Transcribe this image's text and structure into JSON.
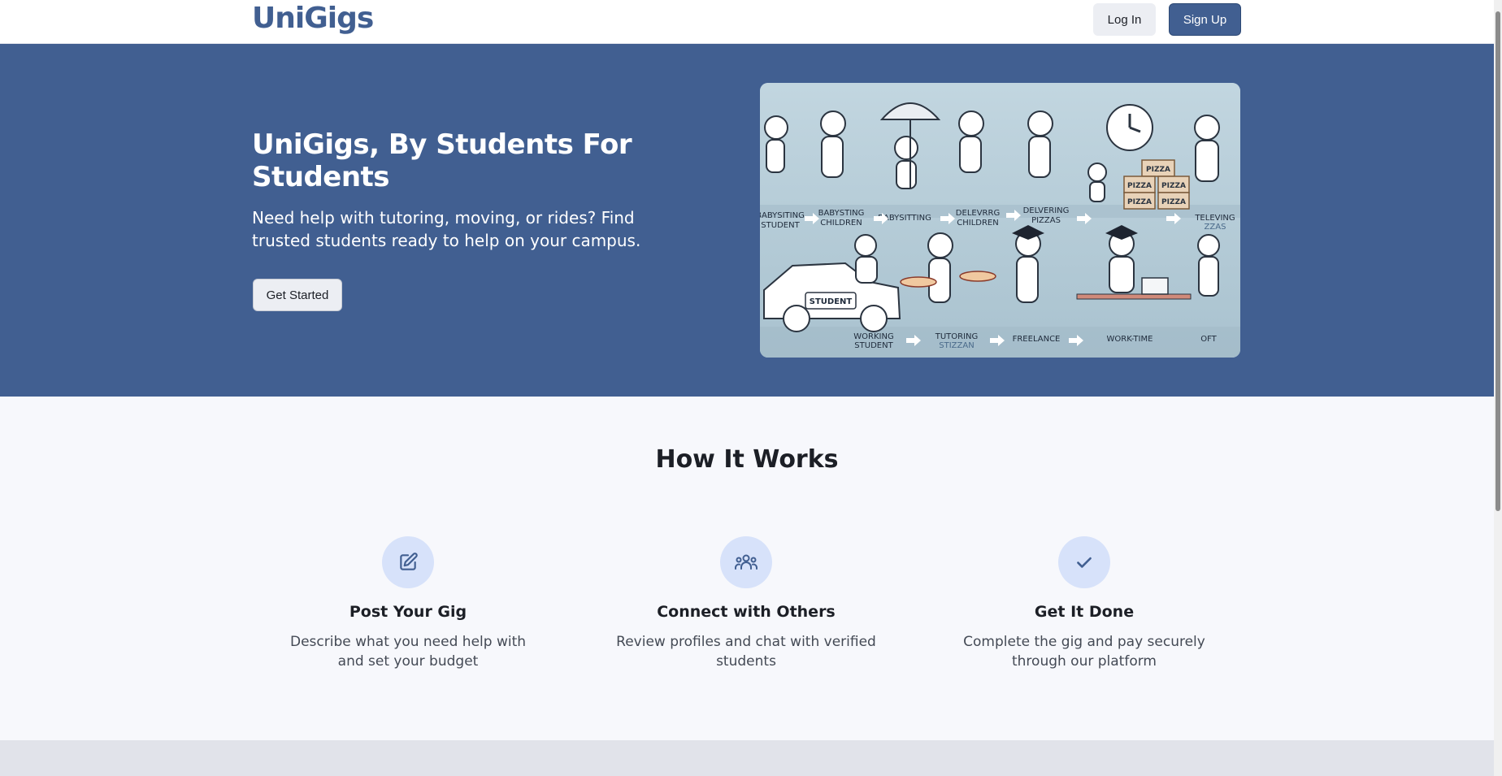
{
  "header": {
    "logo": "UniGigs",
    "login_label": "Log In",
    "signup_label": "Sign Up"
  },
  "hero": {
    "title": "UniGigs, By Students For Students",
    "subtitle": "Need help with tutoring, moving, or rides? Find trusted students ready to help on your campus.",
    "cta_label": "Get Started",
    "image_captions": [
      "BABYSITING STUDENT",
      "BABYSTING CHILDREN",
      "BABYSITTING",
      "DELEVRRG CHILDREN",
      "DELVERING PIZZAS",
      "TELEVING ZZAS",
      "WORKING STUDENT",
      "TUTORING STIZZAN",
      "FREELANCE",
      "WORK-TIME",
      "OFT",
      "STUDENT",
      "PIZZA"
    ]
  },
  "how_it_works": {
    "title": "How It Works",
    "steps": [
      {
        "icon": "edit-icon",
        "title": "Post Your Gig",
        "description": "Describe what you need help with and set your budget"
      },
      {
        "icon": "users-icon",
        "title": "Connect with Others",
        "description": "Review profiles and chat with verified students"
      },
      {
        "icon": "check-icon",
        "title": "Get It Done",
        "description": "Complete the gig and pay securely through our platform"
      }
    ]
  },
  "colors": {
    "primary": "#415f91",
    "icon_bg": "#d7e2fa",
    "page_bg": "#f7f8fc"
  }
}
